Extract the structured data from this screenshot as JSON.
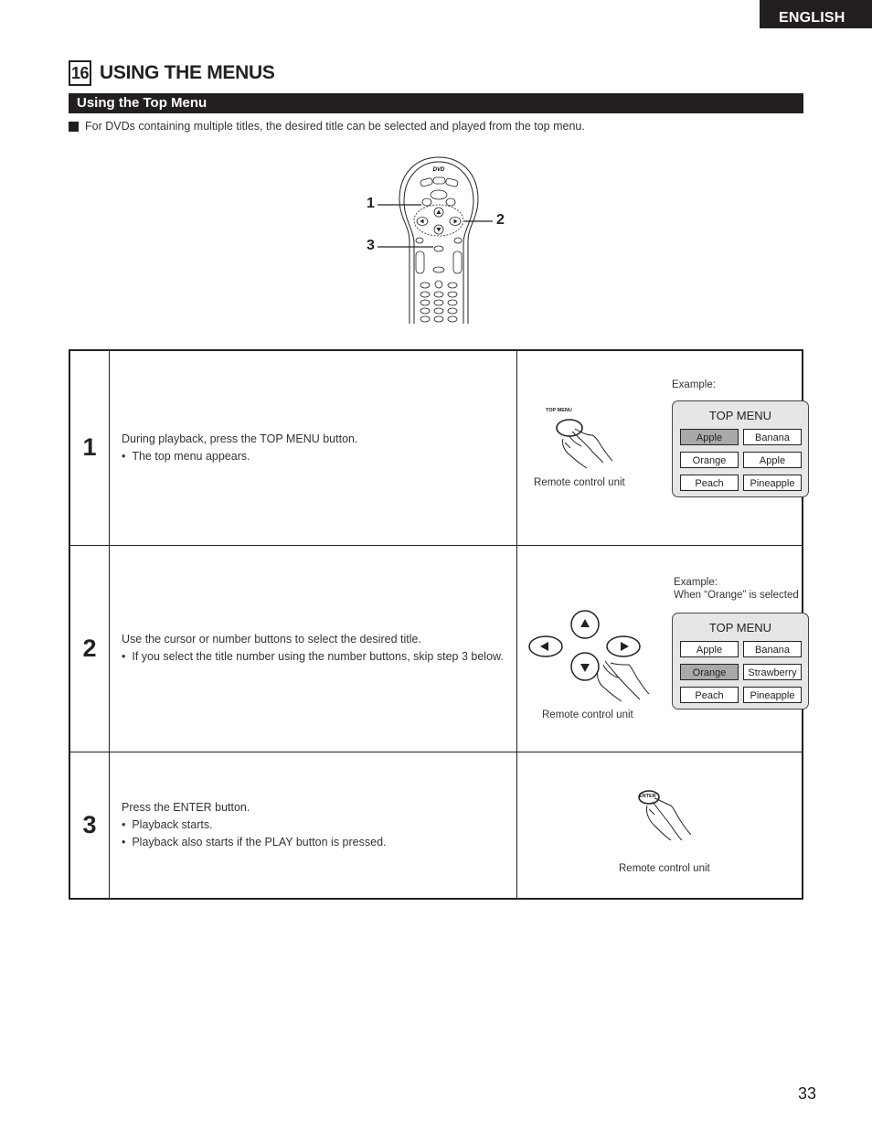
{
  "header": {
    "language_tab": "ENGLISH",
    "section_number": "16",
    "section_title": "USING THE MENUS",
    "subheading": "Using the Top Menu",
    "intro": "For DVDs containing multiple titles, the desired title can be selected and played from the top menu."
  },
  "remote_diagram": {
    "callouts": [
      "1",
      "2",
      "3"
    ],
    "brand_logo": "DVD"
  },
  "steps": [
    {
      "number": "1",
      "instruction": "During playback, press the TOP MENU button.",
      "bullets": [
        "The top menu appears."
      ],
      "button_label": "TOP MENU",
      "remote_caption": "Remote control unit",
      "example_label": "Example:",
      "example_sublabel": "",
      "menu": {
        "title": "TOP MENU",
        "items": [
          "Apple",
          "Banana",
          "Orange",
          "Apple",
          "Peach",
          "Pineapple"
        ],
        "selected": "Apple"
      }
    },
    {
      "number": "2",
      "instruction": "Use the cursor or number buttons to select the desired title.",
      "bullets": [
        "If you select the title number using the number buttons, skip step 3 below."
      ],
      "remote_caption": "Remote control unit",
      "example_label": "Example:",
      "example_sublabel": "When “Orange” is selected",
      "menu": {
        "title": "TOP MENU",
        "items": [
          "Apple",
          "Banana",
          "Orange",
          "Strawberry",
          "Peach",
          "Pineapple"
        ],
        "selected": "Orange"
      }
    },
    {
      "number": "3",
      "instruction": "Press the ENTER button.",
      "bullets": [
        "Playback starts.",
        "Playback also starts if the PLAY button is pressed."
      ],
      "button_label": "ENTER",
      "remote_caption": "Remote control unit"
    }
  ],
  "page_number": "33",
  "bullet_glyph": "•"
}
